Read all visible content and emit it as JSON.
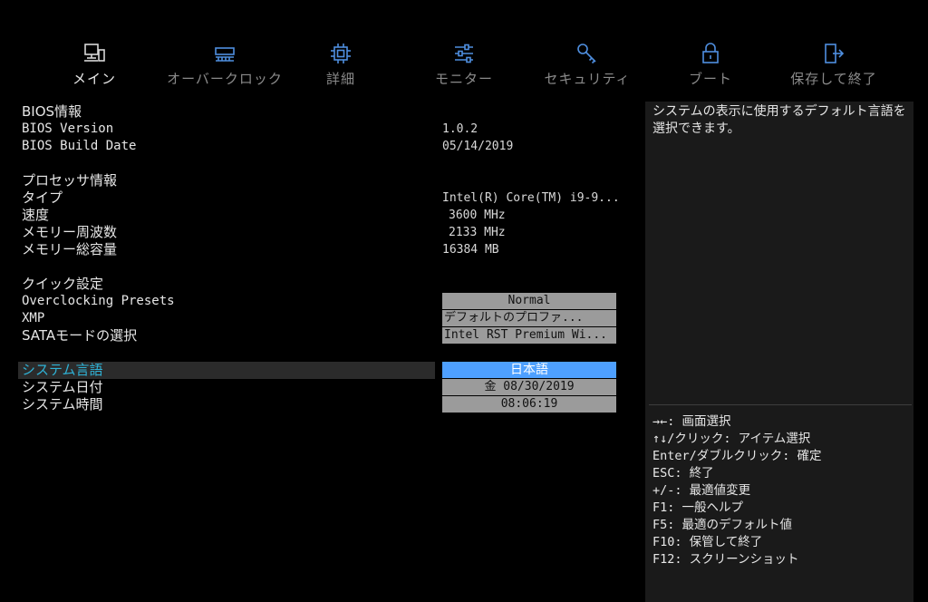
{
  "nav": {
    "tabs": [
      {
        "label": "メイン",
        "icon": "computer-icon",
        "active": true
      },
      {
        "label": "オーバークロック",
        "icon": "memory-module-icon",
        "active": false
      },
      {
        "label": "詳細",
        "icon": "cpu-chip-icon",
        "active": false
      },
      {
        "label": "モニター",
        "icon": "sliders-icon",
        "active": false
      },
      {
        "label": "セキュリティ",
        "icon": "key-icon",
        "active": false
      },
      {
        "label": "ブート",
        "icon": "lock-icon",
        "active": false
      },
      {
        "label": "保存して終了",
        "icon": "exit-door-icon",
        "active": false
      }
    ],
    "icon_color": "#4f8fe0"
  },
  "bios_info": {
    "header": "BIOS情報",
    "version_label": "BIOS Version",
    "version_value": "1.0.2",
    "build_date_label": "BIOS Build Date",
    "build_date_value": "05/14/2019"
  },
  "processor_info": {
    "header": "プロセッサ情報",
    "type_label": "タイプ",
    "type_value": "Intel(R) Core(TM) i9-9...",
    "speed_label": "速度",
    "speed_value": "3600 MHz",
    "mem_freq_label": "メモリー周波数",
    "mem_freq_value": "2133 MHz",
    "mem_total_label": "メモリー総容量",
    "mem_total_value": "16384 MB"
  },
  "quick_settings": {
    "header": "クイック設定",
    "oc_label": "Overclocking Presets",
    "oc_value": "Normal",
    "xmp_label": "XMP",
    "xmp_value": "デフォルトのプロファ...",
    "sata_label": "SATAモードの選択",
    "sata_value": "Intel RST Premium Wi..."
  },
  "system": {
    "lang_label": "システム言語",
    "lang_value": "日本語",
    "date_label": "システム日付",
    "date_value": "金 08/30/2019",
    "time_label": "システム時間",
    "time_value": "08:06:19"
  },
  "help": {
    "description": "システムの表示に使用するデフォルト言語を選択できます。",
    "keys": [
      "→←: 画面選択",
      "↑↓/クリック: アイテム選択",
      "Enter/ダブルクリック: 確定",
      "ESC: 終了",
      "+/-: 最適値変更",
      "F1: 一般ヘルプ",
      "F5: 最適のデフォルト値",
      "F10: 保管して終了",
      "F12: スクリーンショット"
    ]
  },
  "colors": {
    "background": "#000000",
    "panel": "#1a1a1a",
    "selected_field": "#4ea0ff",
    "field": "#9b9b9b",
    "highlight_text": "#2fb3d7"
  }
}
